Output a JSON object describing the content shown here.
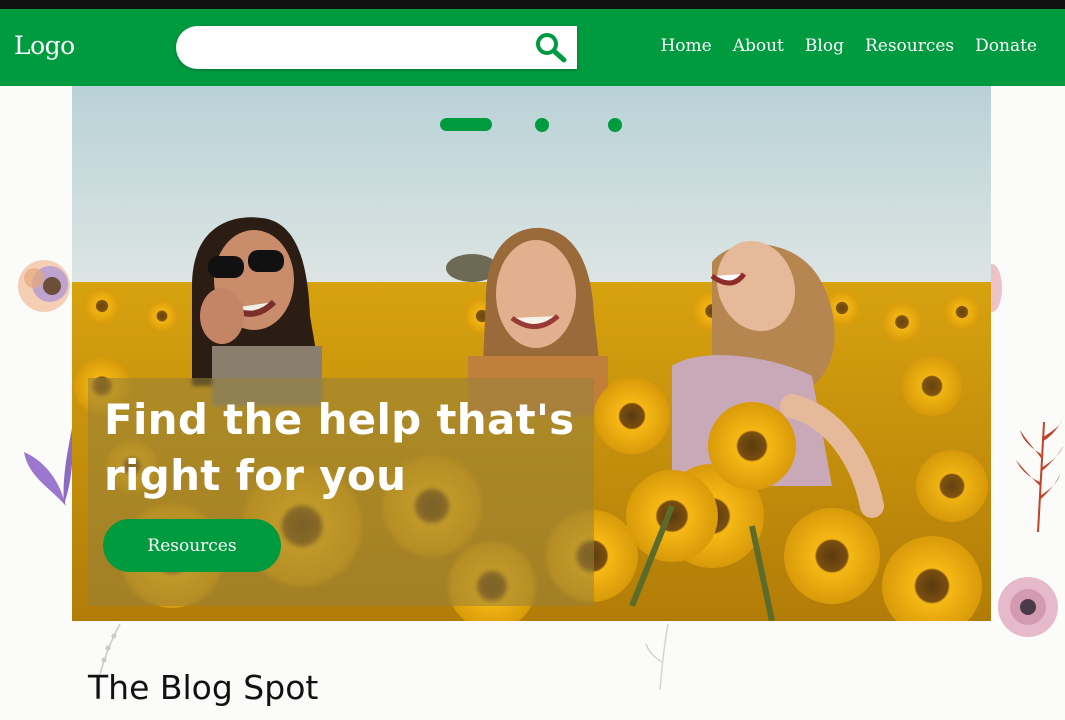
{
  "header": {
    "logo": "Logo",
    "search": {
      "value": "",
      "placeholder": "",
      "icon": "search-icon"
    },
    "nav": [
      {
        "label": "Home"
      },
      {
        "label": "About"
      },
      {
        "label": "Blog"
      },
      {
        "label": "Resources"
      },
      {
        "label": "Donate"
      }
    ]
  },
  "hero": {
    "headline": "Find the help that's right for you",
    "cta_label": "Resources",
    "slides": {
      "count": 3,
      "active": 1
    },
    "image": "three-smiling-women-in-sunflower-field"
  },
  "blog": {
    "title": "The Blog Spot"
  },
  "colors": {
    "brand_green": "#009a3f",
    "top_strip": "#111111",
    "page_bg": "#fbfbf9"
  }
}
